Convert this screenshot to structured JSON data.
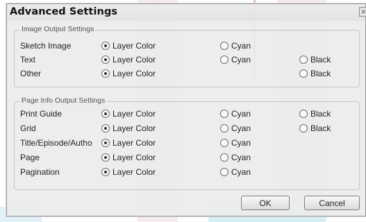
{
  "dialog": {
    "title": "Advanced Settings",
    "close_label": "×"
  },
  "image_output": {
    "legend": "Image Output Settings",
    "rows": [
      {
        "label": "Sketch Image",
        "layer_color": "Layer Color",
        "cyan": "Cyan",
        "black": "",
        "selected": "layer_color"
      },
      {
        "label": "Text",
        "layer_color": "Layer Color",
        "cyan": "Cyan",
        "black": "Black",
        "selected": "layer_color"
      },
      {
        "label": "Other",
        "layer_color": "Layer Color",
        "cyan": "",
        "black": "Black",
        "selected": "layer_color"
      }
    ]
  },
  "page_info_output": {
    "legend": "Page Info Output Settings",
    "rows": [
      {
        "label": "Print Guide",
        "layer_color": "Layer Color",
        "cyan": "Cyan",
        "black": "Black",
        "selected": "layer_color"
      },
      {
        "label": "Grid",
        "layer_color": "Layer Color",
        "cyan": "Cyan",
        "black": "Black",
        "selected": "layer_color"
      },
      {
        "label": "Title/Episode/Autho",
        "layer_color": "Layer Color",
        "cyan": "Cyan",
        "black": "",
        "selected": "layer_color"
      },
      {
        "label": "Page",
        "layer_color": "Layer Color",
        "cyan": "Cyan",
        "black": "",
        "selected": "layer_color"
      },
      {
        "label": "Pagination",
        "layer_color": "Layer Color",
        "cyan": "Cyan",
        "black": "",
        "selected": "layer_color"
      }
    ]
  },
  "buttons": {
    "ok": "OK",
    "cancel": "Cancel"
  }
}
